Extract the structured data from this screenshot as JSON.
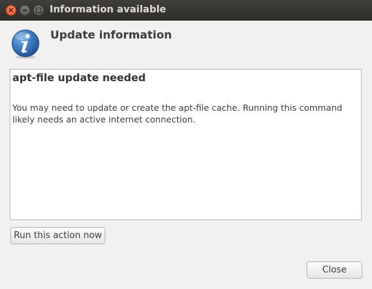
{
  "window": {
    "title": "Information available",
    "close_glyph": "×"
  },
  "header": {
    "title": "Update information",
    "icon": "info-icon"
  },
  "message": {
    "heading": "apt-file update needed",
    "body": "You may need to update or create the apt-file cache. Running this command likely needs an active internet connection."
  },
  "actions": {
    "run_label": "Run this action now",
    "close_label": "Close"
  },
  "colors": {
    "titlebar": "#3c3b37",
    "close_button": "#e95420",
    "info_icon": "#2f6dab"
  }
}
